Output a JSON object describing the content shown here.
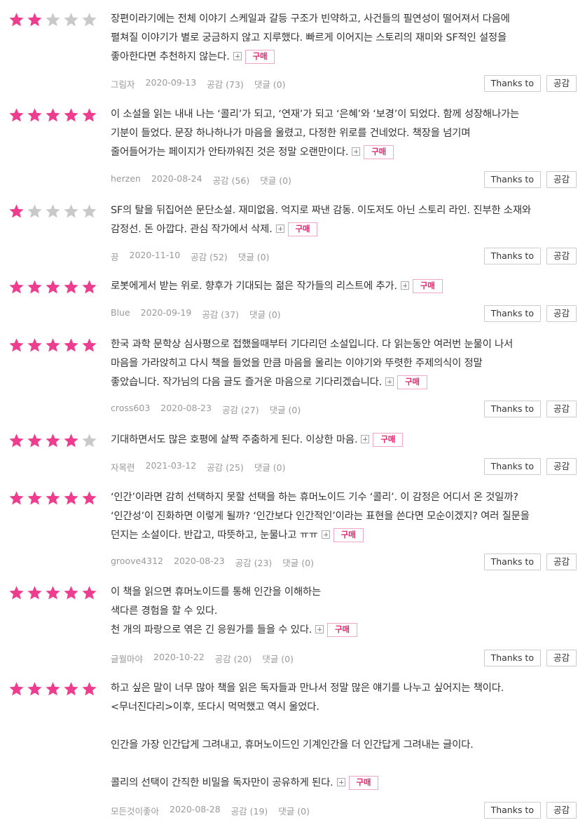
{
  "colors": {
    "star_on": "#ee3d8f",
    "star_off": "#c9c9c9",
    "buy_text": "#e0266d"
  },
  "labels": {
    "buy": "구매",
    "thanks": "Thanks to",
    "empathy_btn": "공감"
  },
  "reviews": [
    {
      "rating": 2,
      "paragraphs": [
        "장편이라기에는 전체 이야기 스케일과 갈등 구조가 빈약하고, 사건들의 필연성이 떨어져서 다음에\n펼쳐질 이야기가 별로 궁금하지 않고 지루했다. 빠르게 이어지는 스토리의 재미와 SF적인 설정을\n좋아한다면 추천하지 않는다."
      ],
      "author": "그림자",
      "date": "2020-09-13",
      "likes": "공감 (73)",
      "comments": "댓글 (0)"
    },
    {
      "rating": 5,
      "paragraphs": [
        "이 소설을 읽는 내내 나는 ‘콜리’가 되고, ‘연재’가 되고 ‘은혜’와 ‘보경’이 되었다. 함께 성장해나가는\n기분이 들었다. 문장 하나하나가 마음을 울렸고, 다정한 위로를 건네었다. 책장을 넘기며\n줄어들어가는 페이지가 안타까워진 것은 정말 오랜만이다."
      ],
      "author": "herzen",
      "date": "2020-08-24",
      "likes": "공감 (56)",
      "comments": "댓글 (0)"
    },
    {
      "rating": 1,
      "paragraphs": [
        "SF의 탈을 뒤집어쓴 문단소설. 재미없음. 억지로 짜낸 감동. 이도저도 아닌 스토리 라인. 진부한 소재와\n감정선. 돈 아깝다. 관심 작가에서 삭제."
      ],
      "author": "끙",
      "date": "2020-11-10",
      "likes": "공감 (52)",
      "comments": "댓글 (0)"
    },
    {
      "rating": 5,
      "paragraphs": [
        "로봇에게서 받는 위로. 향후가 기대되는 젊은 작가들의 리스트에 추가."
      ],
      "author": "Blue",
      "date": "2020-09-19",
      "likes": "공감 (37)",
      "comments": "댓글 (0)"
    },
    {
      "rating": 5,
      "paragraphs": [
        "한국 과학 문학상 심사평으로 접했을때부터 기다리던 소설입니다. 다 읽는동안 여러번 눈물이 나서\n마음을 가라앉히고 다시 책을 들었을 만큼 마음을 울리는 이야기와 뚜렷한 주제의식이 정말\n좋았습니다. 작가님의 다음 글도 즐거운 마음으로 기다리겠습니다."
      ],
      "author": "cross603",
      "date": "2020-08-23",
      "likes": "공감 (27)",
      "comments": "댓글 (0)"
    },
    {
      "rating": 4,
      "paragraphs": [
        "기대하면서도 많은 호평에 살짝 주춤하게 된다. 이상한 마음."
      ],
      "author": "자목련",
      "date": "2021-03-12",
      "likes": "공감 (25)",
      "comments": "댓글 (0)"
    },
    {
      "rating": 5,
      "paragraphs": [
        "‘인간’이라면 감히 선택하지 못할 선택을 하는 휴머노이드 기수 ‘콜리’. 이 감정은 어디서 온 것일까?\n‘인간성’이 진화하면 이렇게 될까? ‘인간보다 인간적인’이라는 표현을 쓴다면 모순이겠지? 여러 질문을\n던지는 소설이다. 반갑고, 따뜻하고, 눈물나고 ㅠㅠ"
      ],
      "author": "groove4312",
      "date": "2020-08-23",
      "likes": "공감 (23)",
      "comments": "댓글 (0)"
    },
    {
      "rating": 5,
      "paragraphs": [
        "이 책을 읽으면 휴머노이드를 통해 인간을 이해하는\n색다른 경험을 할 수 있다.\n천 개의 파랑으로 엮은 긴 응원가를 들을 수 있다."
      ],
      "author": "글월마야",
      "date": "2020-10-22",
      "likes": "공감 (20)",
      "comments": "댓글 (0)"
    },
    {
      "rating": 5,
      "paragraphs": [
        "하고 싶은 말이 너무 많아 책을 읽은 독자들과 만나서 정말 많은 얘기를 나누고 싶어지는 책이다.\n<무너진다리>이후, 또다시 먹먹했고 역시 울었다.",
        "",
        "인간을 가장 인간답게 그려내고, 휴머노이드인 기계인간을 더 인간답게 그려내는 글이다.",
        "",
        "콜리의 선택이 간직한 비밀을 독자만이 공유하게 된다."
      ],
      "author": "모든것이좋아",
      "date": "2020-08-28",
      "likes": "공감 (19)",
      "comments": "댓글 (0)"
    }
  ]
}
